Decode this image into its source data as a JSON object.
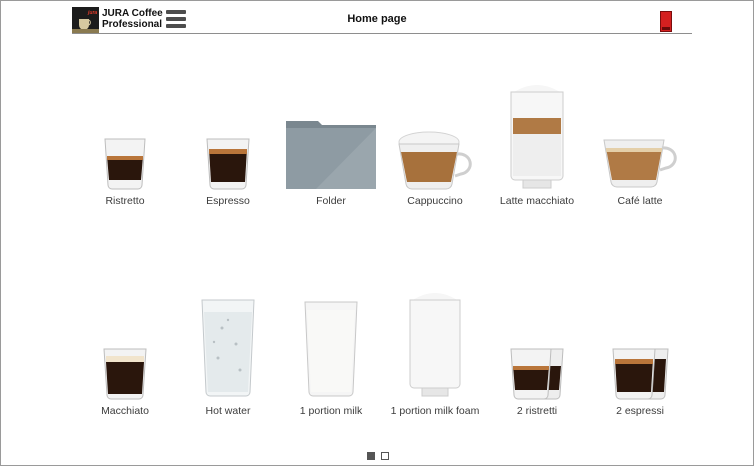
{
  "header": {
    "brand_line1": "JURA Coffee",
    "brand_line2": "Professional",
    "title": "Home page"
  },
  "products": [
    {
      "label": "Ristretto",
      "icon": "ristretto-glass-icon"
    },
    {
      "label": "Espresso",
      "icon": "espresso-glass-icon"
    },
    {
      "label": "Folder",
      "icon": "folder-icon"
    },
    {
      "label": "Cappuccino",
      "icon": "cappuccino-cup-icon"
    },
    {
      "label": "Latte macchiato",
      "icon": "latte-macchiato-glass-icon"
    },
    {
      "label": "Café latte",
      "icon": "cafe-latte-cup-icon"
    },
    {
      "label": "Macchiato",
      "icon": "macchiato-glass-icon"
    },
    {
      "label": "Hot water",
      "icon": "hot-water-glass-icon"
    },
    {
      "label": "1 portion milk",
      "icon": "milk-glass-icon"
    },
    {
      "label": "1 portion milk foam",
      "icon": "milk-foam-glass-icon"
    },
    {
      "label": "2 ristretti",
      "icon": "two-ristretti-glasses-icon"
    },
    {
      "label": "2 espressi",
      "icon": "two-espressi-glasses-icon"
    }
  ],
  "pager": {
    "pages": 2,
    "current": 1
  },
  "colors": {
    "status_red": "#d42020",
    "folder_gray": "#8e9ba3",
    "coffee_dark": "#2a160c"
  }
}
